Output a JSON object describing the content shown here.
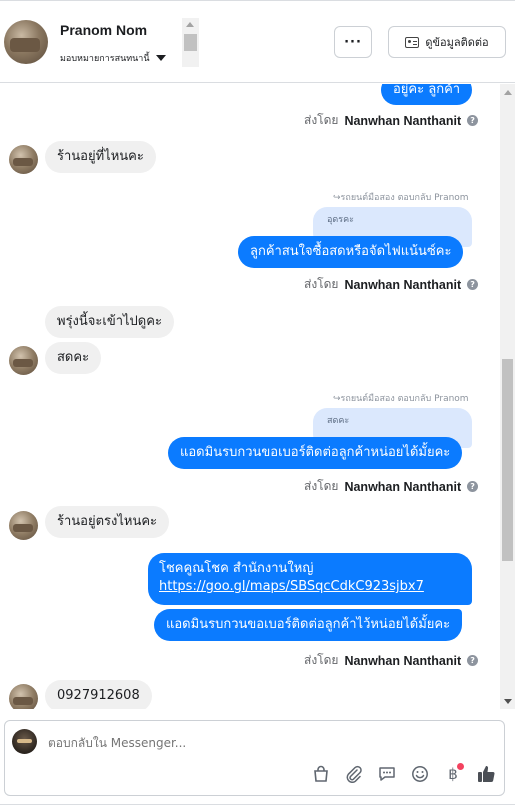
{
  "header": {
    "contact_name": "Pranom Nom",
    "assign_label": "มอบหมายการสนทนานี้",
    "more_label": "···",
    "contact_info_label": "ดูข้อมูลติดต่อ"
  },
  "messages": [
    {
      "id": "m1",
      "type": "out",
      "text": "อยู่คะ ลูกค้า"
    },
    {
      "id": "s1",
      "type": "sentby",
      "prefix": "ส่งโดย",
      "name": "Nanwhan Nanthanit"
    },
    {
      "id": "m2",
      "type": "in",
      "text": "ร้านอยู่ที่ไหนคะ"
    },
    {
      "id": "r1",
      "type": "reply_ref",
      "text": "รถยนต์มือสอง ตอบกลับ Pranom",
      "quote": "อุดรคะ"
    },
    {
      "id": "m3",
      "type": "out",
      "text": "ลูกค้าสนใจซื้อสดหรือจัดไฟแน้นซ์คะ"
    },
    {
      "id": "s2",
      "type": "sentby",
      "prefix": "ส่งโดย",
      "name": "Nanwhan Nanthanit"
    },
    {
      "id": "m4",
      "type": "in",
      "text": "พรุ่งนี้จะเข้าไปดูคะ"
    },
    {
      "id": "m5",
      "type": "in",
      "text": "สดคะ"
    },
    {
      "id": "r2",
      "type": "reply_ref",
      "text": "รถยนต์มือสอง ตอบกลับ Pranom",
      "quote": "สดคะ"
    },
    {
      "id": "m6",
      "type": "out",
      "text": "แอดมินรบกวนขอเบอร์ติดต่อลูกค้าหน่อยได้มั้ยคะ"
    },
    {
      "id": "s3",
      "type": "sentby",
      "prefix": "ส่งโดย",
      "name": "Nanwhan Nanthanit"
    },
    {
      "id": "m7",
      "type": "in",
      "text": "ร้านอยู่ตรงไหนคะ"
    },
    {
      "id": "m8",
      "type": "out",
      "text": "โชคคูณโชค สำนักงานใหญ่",
      "link": "https://goo.gl/maps/SBSqcCdkC923sjbx7"
    },
    {
      "id": "m9",
      "type": "out",
      "text": "แอดมินรบกวนขอเบอร์ติดต่อลูกค้าไว้หน่อยได้มั้ยคะ"
    },
    {
      "id": "s4",
      "type": "sentby",
      "prefix": "ส่งโดย",
      "name": "Nanwhan Nanthanit"
    },
    {
      "id": "m10",
      "type": "in",
      "text": "0927912608"
    }
  ],
  "composer": {
    "placeholder": "ตอบกลับใน Messenger...",
    "tool_icons": [
      "shopping-bag-icon",
      "paperclip-icon",
      "saved-reply-icon",
      "emoji-icon",
      "baht-payment-icon",
      "thumbs-up-icon"
    ],
    "baht_symbol": "฿"
  },
  "colors": {
    "outgoing_bubble": "#0b7bff",
    "incoming_bubble": "#f0f0f0",
    "quote_bubble": "#dbe8fd",
    "notification_dot": "#f3425f"
  }
}
